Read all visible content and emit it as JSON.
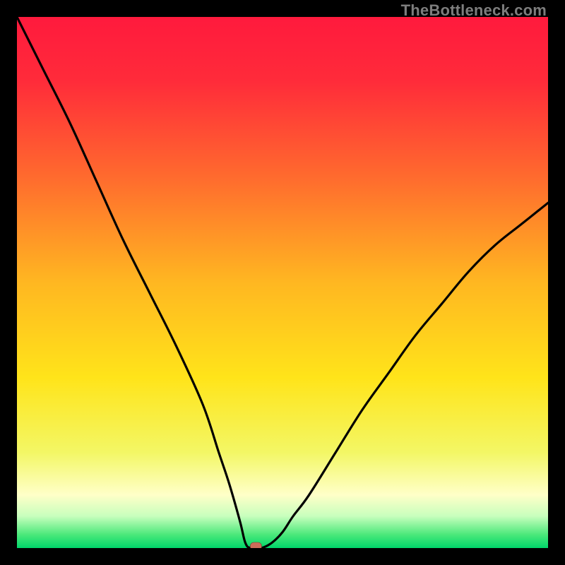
{
  "watermark": "TheBottleneck.com",
  "chart_data": {
    "type": "line",
    "title": "",
    "xlabel": "",
    "ylabel": "",
    "xlim": [
      0,
      100
    ],
    "ylim": [
      0,
      100
    ],
    "series": [
      {
        "name": "bottleneck-curve",
        "x": [
          0,
          2,
          5,
          10,
          15,
          20,
          25,
          30,
          35,
          38,
          40,
          42,
          43,
          44,
          46,
          48,
          50,
          52,
          55,
          60,
          65,
          70,
          75,
          80,
          85,
          90,
          95,
          100
        ],
        "y": [
          100,
          96,
          90,
          80,
          69,
          58,
          48,
          38,
          27,
          18,
          12,
          5,
          1,
          0,
          0,
          1,
          3,
          6,
          10,
          18,
          26,
          33,
          40,
          46,
          52,
          57,
          61,
          65
        ]
      }
    ],
    "marker": {
      "x": 45,
      "y": 0
    },
    "gradient_stops": [
      {
        "offset": 0.0,
        "color": "#ff1a3d"
      },
      {
        "offset": 0.12,
        "color": "#ff2b3a"
      },
      {
        "offset": 0.3,
        "color": "#ff6a2e"
      },
      {
        "offset": 0.5,
        "color": "#ffb721"
      },
      {
        "offset": 0.68,
        "color": "#ffe41a"
      },
      {
        "offset": 0.82,
        "color": "#f3f765"
      },
      {
        "offset": 0.9,
        "color": "#ffffc8"
      },
      {
        "offset": 0.94,
        "color": "#c8ffbd"
      },
      {
        "offset": 0.975,
        "color": "#4ae87a"
      },
      {
        "offset": 1.0,
        "color": "#00d66a"
      }
    ]
  }
}
